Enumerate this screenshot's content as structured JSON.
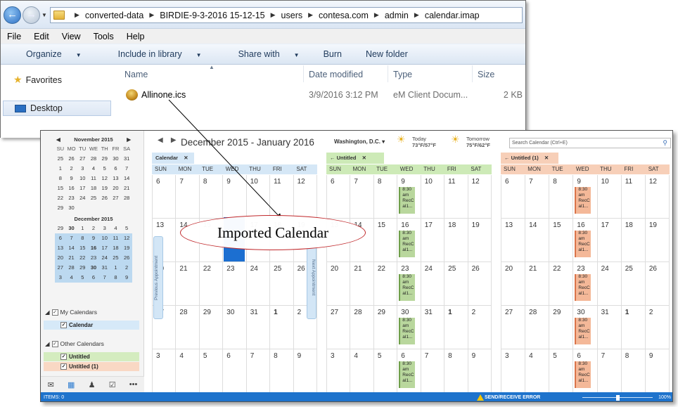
{
  "explorer": {
    "path": [
      "converted-data",
      "BIRDIE-9-3-2016 15-12-15",
      "users",
      "contesa.com",
      "admin",
      "calendar.imap"
    ],
    "menu": [
      "File",
      "Edit",
      "View",
      "Tools",
      "Help"
    ],
    "toolbar": [
      "Organize",
      "Include in library",
      "Share with",
      "Burn",
      "New folder"
    ],
    "nav": {
      "favorites": "Favorites",
      "desktop": "Desktop"
    },
    "columns": {
      "name": "Name",
      "date": "Date modified",
      "type": "Type",
      "size": "Size"
    },
    "file": {
      "name": "Allinone.ics",
      "date": "3/9/2016 3:12 PM",
      "type": "eM Client Docum...",
      "size": "2 KB"
    }
  },
  "emclient": {
    "mini_nov": {
      "title": "November 2015",
      "dow": [
        "SU",
        "MO",
        "TU",
        "WE",
        "TH",
        "FR",
        "SA"
      ],
      "days": [
        "25",
        "26",
        "27",
        "28",
        "29",
        "30",
        "31",
        "1",
        "2",
        "3",
        "4",
        "5",
        "6",
        "7",
        "8",
        "9",
        "10",
        "11",
        "12",
        "13",
        "14",
        "15",
        "16",
        "17",
        "18",
        "19",
        "20",
        "21",
        "22",
        "23",
        "24",
        "25",
        "26",
        "27",
        "28",
        "29",
        "30"
      ]
    },
    "mini_dec": {
      "title": "December 2015",
      "days": [
        "29",
        "30",
        "1",
        "2",
        "3",
        "4",
        "5",
        "6",
        "7",
        "8",
        "9",
        "10",
        "11",
        "12",
        "13",
        "14",
        "15",
        "16",
        "17",
        "18",
        "19",
        "20",
        "21",
        "22",
        "23",
        "24",
        "25",
        "26",
        "27",
        "28",
        "29",
        "30",
        "31",
        "1",
        "2",
        "3",
        "4",
        "5",
        "6",
        "7",
        "8",
        "9"
      ]
    },
    "my_calendars": "My Calendars",
    "calendar_item": "Calendar",
    "other_calendars": "Other Calendars",
    "untitled": "Untitled",
    "untitled1": "Untitled (1)",
    "date_range": "December 2015 - January 2016",
    "location": "Washington, D.C.",
    "weather": {
      "today_label": "Today",
      "today_temp": "73°F/57°F",
      "tomorrow_label": "Tomorrow",
      "tomorrow_temp": "75°F/62°F"
    },
    "search_placeholder": "Search Calendar (Ctrl+E)",
    "dow": [
      "SUN",
      "MON",
      "TUE",
      "WED",
      "THU",
      "FRI",
      "SAT"
    ],
    "tabs": [
      "Calendar",
      "Untitled",
      "Untitled (1)"
    ],
    "weeks": [
      [
        "6",
        "7",
        "8",
        "9",
        "10",
        "11",
        "12"
      ],
      [
        "13",
        "14",
        "15",
        "16",
        "17",
        "18",
        "19"
      ],
      [
        "20",
        "21",
        "22",
        "23",
        "24",
        "25",
        "26"
      ],
      [
        "27",
        "28",
        "29",
        "30",
        "31",
        "1",
        "2"
      ],
      [
        "3",
        "4",
        "5",
        "6",
        "7",
        "8",
        "9"
      ]
    ],
    "event_text": [
      "8:30",
      "am",
      "RecC",
      "al1..."
    ],
    "prev_appt": "Previous Appointment",
    "next_appt": "Next Appointment",
    "status": {
      "items": "ITEMS: 0",
      "error": "SEND/RECEIVE ERROR",
      "zoom": "100%"
    }
  },
  "annotation": {
    "text": "Imported Calendar"
  }
}
